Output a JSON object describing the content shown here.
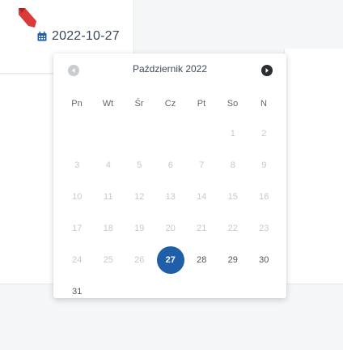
{
  "date_field": {
    "value": "2022-10-27",
    "icon": "calendar-icon"
  },
  "datepicker": {
    "month_title": "Październik 2022",
    "prev_icon": "chevron-left-circle-icon",
    "next_icon": "chevron-right-circle-icon",
    "weekdays": [
      "Pn",
      "Wt",
      "Śr",
      "Cz",
      "Pt",
      "So",
      "N"
    ],
    "weeks": [
      [
        "",
        "",
        "",
        "",
        "",
        "1",
        "2"
      ],
      [
        "3",
        "4",
        "5",
        "6",
        "7",
        "8",
        "9"
      ],
      [
        "10",
        "11",
        "12",
        "13",
        "14",
        "15",
        "16"
      ],
      [
        "17",
        "18",
        "19",
        "20",
        "21",
        "22",
        "23"
      ],
      [
        "24",
        "25",
        "26",
        "27",
        "28",
        "29",
        "30"
      ],
      [
        "31",
        "",
        "",
        "",
        "",
        "",
        ""
      ]
    ],
    "selected_day": "27",
    "enabled_days": [
      "27",
      "28",
      "29",
      "30",
      "31"
    ],
    "colors": {
      "selected": "#1e5fa8",
      "disabled_text": "#c5cacf",
      "enabled_text": "#4a5561"
    }
  }
}
